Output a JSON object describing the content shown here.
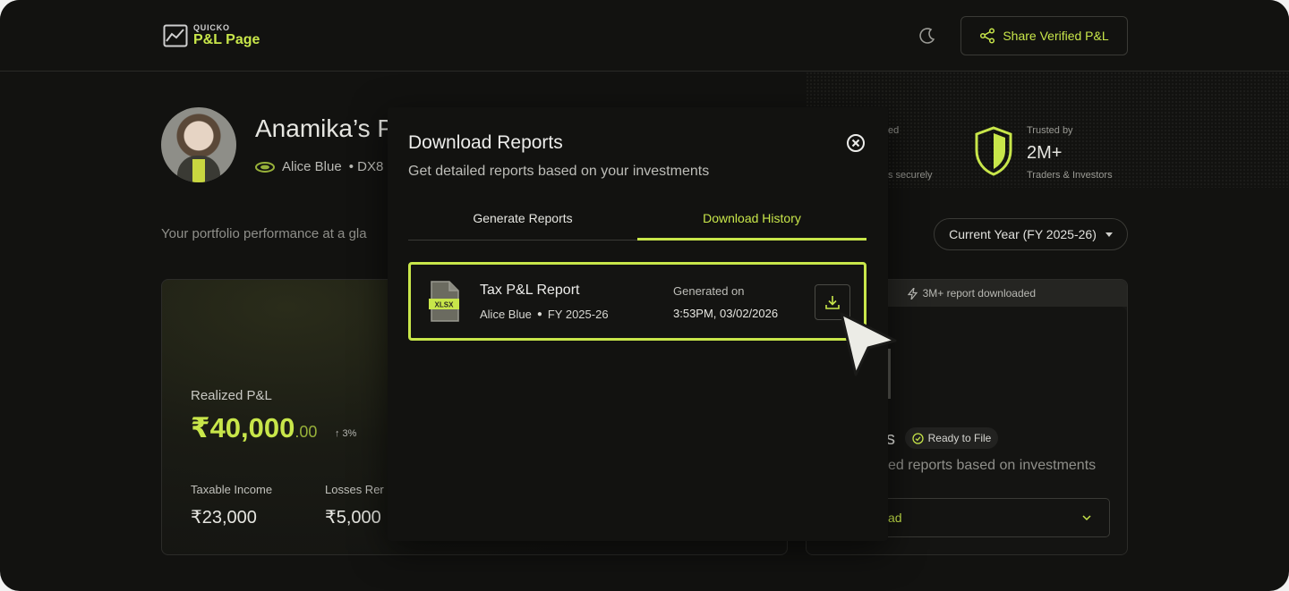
{
  "header": {
    "logo_top": "QUICKO",
    "logo_main": "P&L Page",
    "share_label": "Share Verified P&L"
  },
  "profile": {
    "name": "Anamika’s P",
    "broker": "Alice Blue",
    "broker_suffix": "• DX8"
  },
  "trust": {
    "left_top": "ed",
    "left_bottom": "s securely",
    "by_label": "Trusted by",
    "count": "2M+",
    "audience": "Traders & Investors"
  },
  "tagline": "Your portfolio performance at a gla",
  "year_select": "Current Year (FY 2025-26)",
  "pnl": {
    "label": "Realized P&L",
    "value": "₹40,000",
    "decimals": ".00",
    "change": "↑ 3%",
    "taxable_label": "Taxable Income",
    "taxable_value": "₹23,000",
    "losses_label": "Losses Rer",
    "losses_value": "₹5,000"
  },
  "report_card": {
    "badge": "3M+ report downloaded",
    "title_fragment": "s",
    "ready": "Ready to File",
    "subtitle": "ed reports based on investments",
    "select_text": "ad"
  },
  "modal": {
    "title": "Download Reports",
    "subtitle": "Get detailed reports based on your investments",
    "tabs": [
      "Generate Reports",
      "Download History"
    ],
    "active_tab": "Download History",
    "rows": [
      {
        "name": "Tax P&L Report",
        "broker": "Alice Blue",
        "fy": "FY 2025-26",
        "file_type": "XLSX",
        "generated_label": "Generated on",
        "generated_value": "3:53PM, 03/02/2026"
      }
    ]
  },
  "colors": {
    "accent": "#c8e64a",
    "background": "#121210"
  },
  "icons": [
    "chart-logo-icon",
    "moon-icon",
    "share-icon",
    "broker-icon",
    "shield-icon",
    "lightning-icon",
    "check-circle-icon",
    "chevron-down-icon",
    "close-icon",
    "xlsx-file-icon",
    "download-icon",
    "cursor-icon"
  ]
}
